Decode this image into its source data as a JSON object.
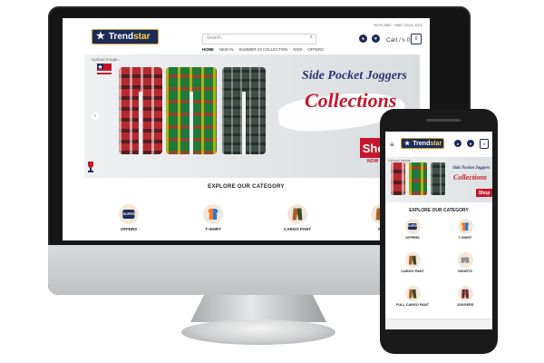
{
  "brand": {
    "name_prefix": "Trend",
    "name_suffix": "star",
    "star_glyph": "★"
  },
  "header": {
    "hotline": "HOTLINE: +880 1XXX-XXX",
    "search_placeholder": "Search...",
    "search_icon": "search-icon",
    "cart_label": "Cart / ৳ 0",
    "cart_count": "0",
    "user_glyph": "●",
    "heart_glyph": "♥"
  },
  "nav": {
    "items": [
      "HOME",
      "NEW IN",
      "SUMMER-23 COLLECTION",
      "KIDS",
      "OFFERS"
    ]
  },
  "banner": {
    "upload_text": "Upload Image...",
    "title_line1": "Side Pocket Joggers",
    "title_line2": "Collections",
    "shop_label": "Sho",
    "now_label": "NOW",
    "prev_arrow": "‹"
  },
  "categories": {
    "heading": "EXPLORE OUR CATEGORY",
    "desktop": [
      "OFFERS",
      "T-SHIRT",
      "CARGO PANT",
      "SH"
    ],
    "mobile": [
      "OFFERS",
      "T-SHIRT",
      "CARGO PANT",
      "SHORTS",
      "FULL CARGO PANT",
      "JOGGERS"
    ],
    "super_badge": "SUPER"
  },
  "mobile": {
    "menu_glyph": "≡",
    "banner_title1": "Side Pocket Joggers",
    "banner_title2": "Collections",
    "shop_label": "Shop",
    "upload_text": "Upload Image..."
  },
  "colors": {
    "navy": "#1d2b5a",
    "accent_red": "#c4172c",
    "gold": "#ffd43a"
  }
}
